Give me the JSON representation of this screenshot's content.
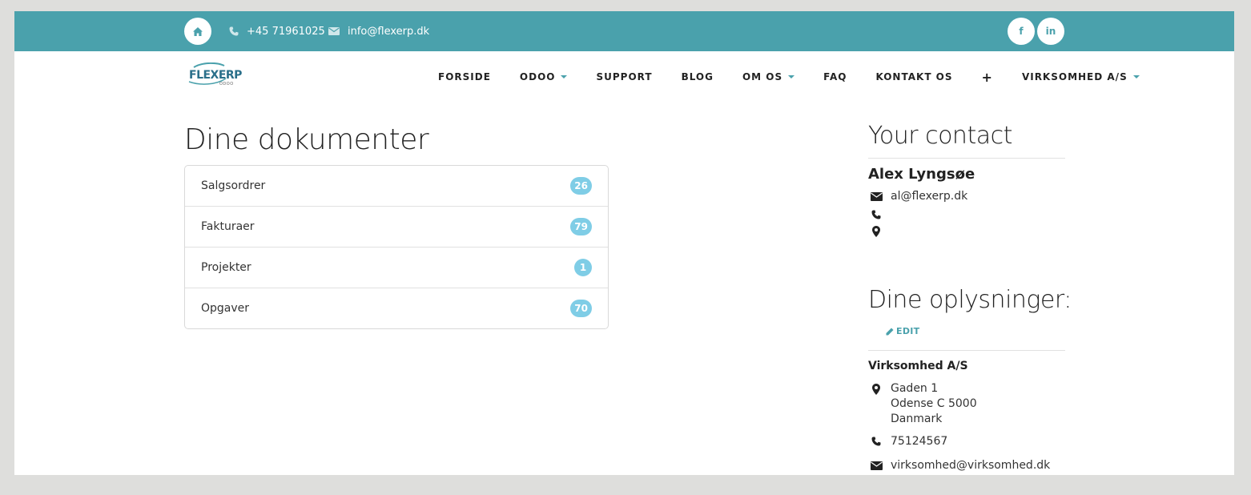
{
  "topbar": {
    "phone": "+45 71961025",
    "email": "info@flexerp.dk",
    "social": [
      {
        "name": "facebook",
        "label": "f"
      },
      {
        "name": "linkedin",
        "label": "in"
      }
    ]
  },
  "logo": {
    "brand": "FLEXERP",
    "tagline": "ODOO"
  },
  "nav": {
    "items": [
      {
        "label": "FORSIDE",
        "dropdown": false
      },
      {
        "label": "ODOO",
        "dropdown": true
      },
      {
        "label": "SUPPORT",
        "dropdown": false
      },
      {
        "label": "BLOG",
        "dropdown": false
      },
      {
        "label": "OM OS",
        "dropdown": true
      },
      {
        "label": "FAQ",
        "dropdown": false
      },
      {
        "label": "KONTAKT OS",
        "dropdown": false
      },
      {
        "label": "+",
        "dropdown": false
      },
      {
        "label": "VIRKSOMHED A/S",
        "dropdown": true
      }
    ]
  },
  "main": {
    "title": "Dine dokumenter",
    "documents": [
      {
        "label": "Salgsordrer",
        "count": "26"
      },
      {
        "label": "Fakturaer",
        "count": "79"
      },
      {
        "label": "Projekter",
        "count": "1"
      },
      {
        "label": "Opgaver",
        "count": "70"
      }
    ]
  },
  "contact": {
    "title": "Your contact",
    "name": "Alex Lyngsøe",
    "email": "al@flexerp.dk"
  },
  "info": {
    "title": "Dine oplysninger:",
    "edit_label": "EDIT",
    "company": "Virksomhed A/S",
    "address": [
      "Gaden 1",
      "Odense C 5000",
      "Danmark"
    ],
    "phone": "75124567",
    "email": "virksomhed@virksomhed.dk"
  },
  "colors": {
    "accent": "#4aa1ac",
    "badge": "#7fcde6"
  }
}
